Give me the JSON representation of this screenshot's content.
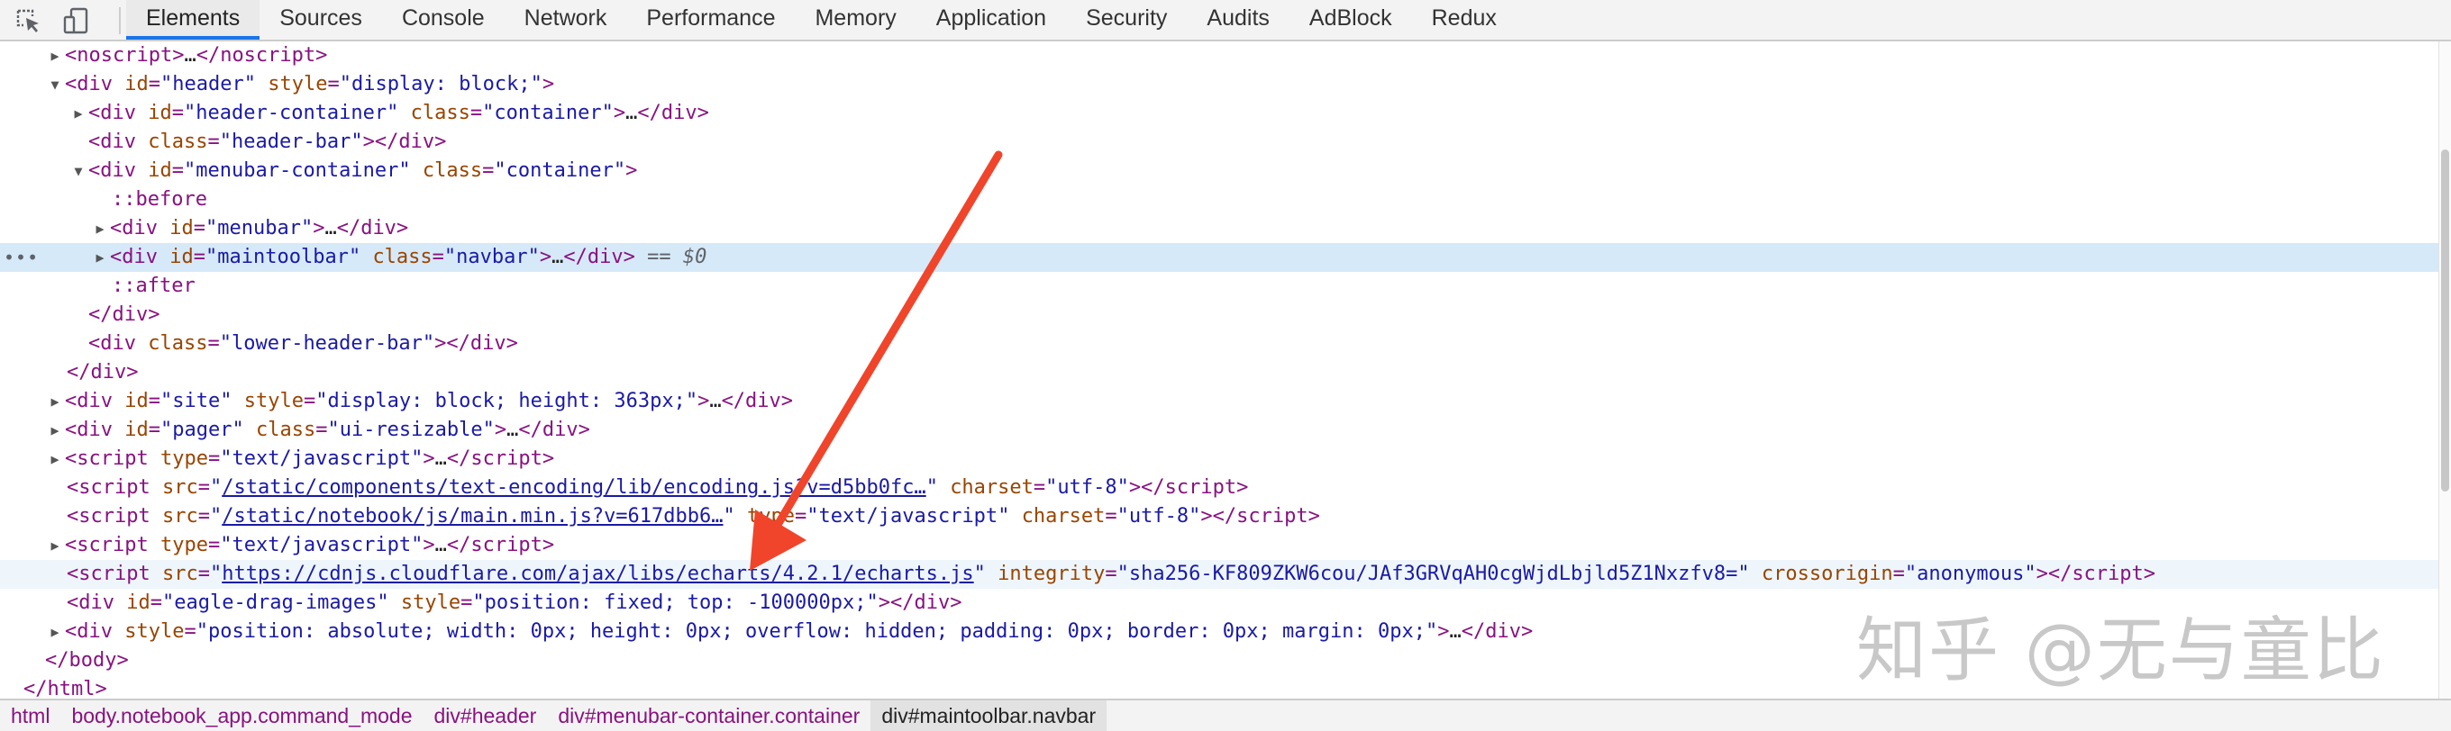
{
  "tabs": [
    "Elements",
    "Sources",
    "Console",
    "Network",
    "Performance",
    "Memory",
    "Application",
    "Security",
    "Audits",
    "AdBlock",
    "Redux"
  ],
  "active_tab": "Elements",
  "icons": [
    "inspect-element-icon",
    "device-toolbar-icon"
  ],
  "tree": {
    "noscript_open": "<noscript>",
    "noscript_close": "</noscript>",
    "ellipsis": "…",
    "header_id": "header",
    "header_style": "display: block;",
    "header_container_id": "header-container",
    "container_class": "container",
    "header_bar_class": "header-bar",
    "menubar_container_id": "menubar-container",
    "before": "::before",
    "menubar_id": "menubar",
    "maintoolbar_id": "maintoolbar",
    "navbar_class": "navbar",
    "selected_suffix": " == $0",
    "after": "::after",
    "lower_header_bar_class": "lower-header-bar",
    "site_id": "site",
    "site_style": "display: block; height: 363px;",
    "pager_id": "pager",
    "pager_class": "ui-resizable",
    "script_type": "text/javascript",
    "encoding_src": "/static/components/text-encoding/lib/encoding.js?v=d5bb0fc…",
    "charset": "utf-8",
    "main_src": "/static/notebook/js/main.min.js?v=617dbb6…",
    "echarts_src": "https://cdnjs.cloudflare.com/ajax/libs/echarts/4.2.1/echarts.js",
    "integrity": "sha256-KF809ZKW6cou/JAf3GRVqAH0cgWjdLbjld5Z1Nxzfv8=",
    "crossorigin": "anonymous",
    "eagle_id": "eagle-drag-images",
    "eagle_style": "position: fixed; top: -100000px;",
    "hidden_div_style": "position: absolute; width: 0px; height: 0px; overflow: hidden; padding: 0px; border: 0px; margin: 0px;",
    "body_close": "</body>",
    "html_close": "</html>"
  },
  "breadcrumbs": [
    "html",
    "body.notebook_app.command_mode",
    "div#header",
    "div#menubar-container.container",
    "div#maintoolbar.navbar"
  ],
  "watermark": "知乎 @无与童比",
  "colors": {
    "arrow": "#f0452b",
    "selected_row": "#d6e9f8",
    "tab_underline": "#1a73e8"
  }
}
